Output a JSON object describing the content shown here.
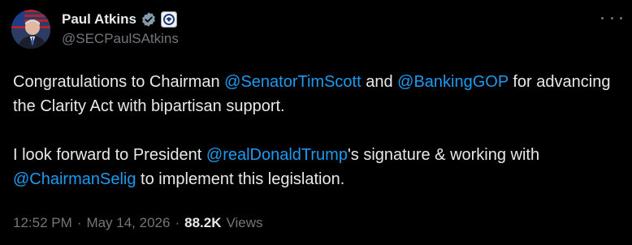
{
  "author": {
    "display_name": "Paul Atkins",
    "handle": "@SECPaulSAtkins",
    "verified_badge_icon": "verified-check-icon",
    "affiliate_badge_icon": "sec-seal-icon"
  },
  "tweet": {
    "paragraph1": {
      "t1": "Congratulations to Chairman ",
      "m1": "@SenatorTimScott",
      "t2": " and ",
      "m2": "@BankingGOP",
      "t3": " for advancing the Clarity Act with bipartisan support."
    },
    "paragraph2": {
      "t1": "I look forward to President ",
      "m1": "@realDonaldTrump",
      "t2": "'s signature & working with ",
      "m2": "@ChairmanSelig",
      "t3": " to implement this legislation."
    }
  },
  "meta": {
    "time": "12:52 PM",
    "sep1": "·",
    "date": "May 14, 2026",
    "sep2": "·",
    "views_count": "88.2K",
    "views_label": "Views"
  },
  "colors": {
    "background": "#000000",
    "text": "#e7e9ea",
    "secondary": "#71767b",
    "accent": "#1d9bf0"
  }
}
